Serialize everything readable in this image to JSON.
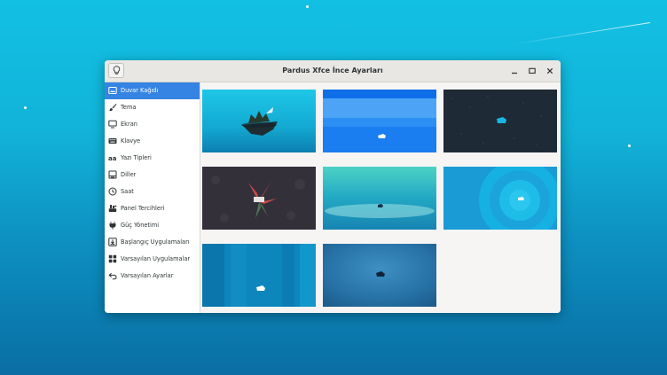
{
  "window": {
    "title": "Pardus Xfce İnce Ayarları"
  },
  "header_button": {
    "icon": "lightbulb-icon"
  },
  "window_controls": {
    "minimize": "minimize-icon",
    "maximize": "maximize-icon",
    "close": "close-icon"
  },
  "sidebar": {
    "items": [
      {
        "label": "Duvar Kağıdı",
        "icon": "wallpaper-icon",
        "active": true
      },
      {
        "label": "Tema",
        "icon": "theme-brush-icon"
      },
      {
        "label": "Ekran",
        "icon": "monitor-icon"
      },
      {
        "label": "Klavye",
        "icon": "keyboard-icon"
      },
      {
        "label": "Yazı Tipleri",
        "icon": "font-icon"
      },
      {
        "label": "Diller",
        "icon": "language-icon"
      },
      {
        "label": "Saat",
        "icon": "clock-icon"
      },
      {
        "label": "Panel Tercihleri",
        "icon": "panel-icon"
      },
      {
        "label": "Güç Yönetimi",
        "icon": "power-icon"
      },
      {
        "label": "Başlangıç Uygulamaları",
        "icon": "startup-icon"
      },
      {
        "label": "Varsayılan Uygulamalar",
        "icon": "apps-grid-icon"
      },
      {
        "label": "Varsayılan Ayarlar",
        "icon": "reset-icon"
      }
    ]
  },
  "wallpapers": [
    {
      "name": "floating-island"
    },
    {
      "name": "blue-bands"
    },
    {
      "name": "dark-pattern"
    },
    {
      "name": "dark-floral"
    },
    {
      "name": "teal-landscape"
    },
    {
      "name": "blue-swirl"
    },
    {
      "name": "blue-pillars"
    },
    {
      "name": "deep-blue-gradient"
    }
  ],
  "colors": {
    "accent": "#3584e4",
    "titlebar": "#e9e7e4",
    "window_bg": "#f6f5f4"
  }
}
